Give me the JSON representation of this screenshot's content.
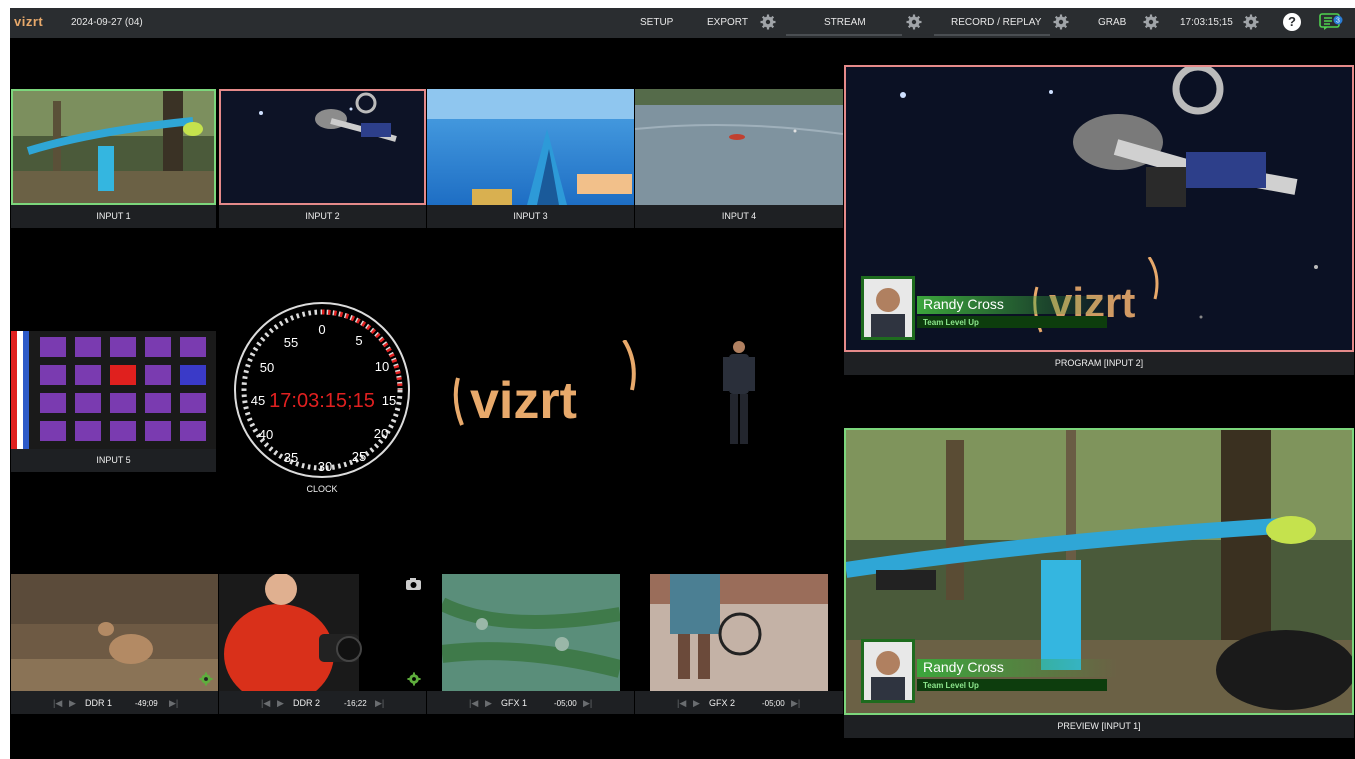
{
  "topbar": {
    "logo": "vizrt",
    "date": "2024-09-27 (04)",
    "setup": "SETUP",
    "export": "EXPORT",
    "stream": "STREAM",
    "record_replay": "RECORD / REPLAY",
    "grab": "GRAB",
    "clock": "17:03:15;15",
    "help": "?",
    "notifications": "3"
  },
  "inputs": [
    {
      "label": "INPUT 1"
    },
    {
      "label": "INPUT 2"
    },
    {
      "label": "INPUT 3"
    },
    {
      "label": "INPUT 4"
    },
    {
      "label": "INPUT 5"
    }
  ],
  "clock": {
    "label": "CLOCK",
    "time": "17:03:15;15",
    "dial_numbers": [
      "0",
      "5",
      "10",
      "15",
      "20",
      "25",
      "30",
      "35",
      "40",
      "45",
      "50",
      "55"
    ]
  },
  "center_logo": "vizrt",
  "players": [
    {
      "label": "DDR 1",
      "time": "-49;09"
    },
    {
      "label": "DDR 2",
      "time": "-16;22"
    },
    {
      "label": "GFX 1",
      "time": "-05;00"
    },
    {
      "label": "GFX 2",
      "time": "-05;00"
    }
  ],
  "program": {
    "label": "PROGRAM [INPUT 2]",
    "overlay_logo": "vizrt",
    "name": "Randy Cross",
    "subtitle": "Team Level Up"
  },
  "preview": {
    "label": "PREVIEW [INPUT 1]",
    "name": "Randy Cross",
    "subtitle": "Team Level Up"
  },
  "colors": {
    "program_border": "#e58a8a",
    "preview_border": "#7cd67c",
    "accent_orange": "#e8a96b",
    "clock_red": "#e02020"
  }
}
